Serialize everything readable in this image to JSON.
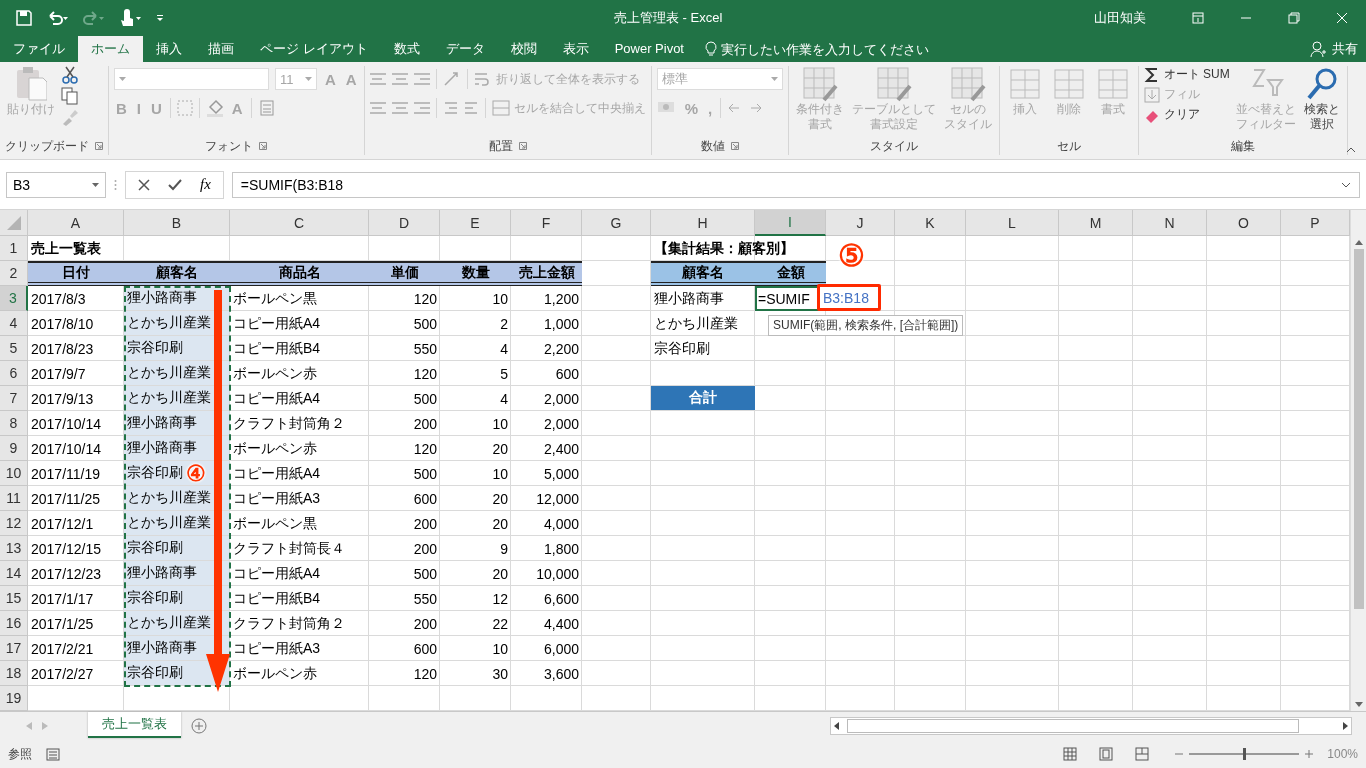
{
  "title_bar": {
    "title": "売上管理表 - Excel",
    "user": "山田知美"
  },
  "menu_tabs": [
    {
      "label": "ファイル",
      "selected": false
    },
    {
      "label": "ホーム",
      "selected": true
    },
    {
      "label": "挿入",
      "selected": false
    },
    {
      "label": "描画",
      "selected": false
    },
    {
      "label": "ページ レイアウト",
      "selected": false
    },
    {
      "label": "数式",
      "selected": false
    },
    {
      "label": "データ",
      "selected": false
    },
    {
      "label": "校閲",
      "selected": false
    },
    {
      "label": "表示",
      "selected": false
    },
    {
      "label": "Power Pivot",
      "selected": false
    }
  ],
  "tell_me": {
    "placeholder": "実行したい作業を入力してください"
  },
  "share": "共有",
  "ribbon": [
    {
      "label": "クリップボード",
      "commands": [
        {
          "lines": [
            "貼り付け"
          ],
          "disabled": true
        }
      ]
    },
    {
      "label": "フォント",
      "commands": [
        {
          "kind": "field",
          "disabled": true
        },
        {
          "kind": "field",
          "value": "11",
          "disabled": true
        },
        {
          "kind": "glyph",
          "label": "A",
          "disabled": true
        },
        {
          "kind": "glyph",
          "label": "A",
          "disabled": true
        },
        {
          "kind": "glyph",
          "label": "B",
          "disabled": true
        },
        {
          "kind": "glyph",
          "label": "I",
          "disabled": true
        },
        {
          "kind": "glyph",
          "label": "U",
          "disabled": true
        },
        {
          "kind": "glyph",
          "label": "A",
          "disabled": true
        }
      ]
    },
    {
      "label": "配置",
      "commands": [
        {
          "label": "折り返して全体を表示する",
          "disabled": true
        },
        {
          "label": "セルを結合して中央揃え",
          "disabled": true
        }
      ]
    },
    {
      "label": "数値",
      "commands": [
        {
          "kind": "field",
          "value": "標準",
          "disabled": true
        },
        {
          "kind": "glyph",
          "label": "%",
          "disabled": true
        },
        {
          "kind": "glyph",
          "label": ",",
          "disabled": true
        }
      ]
    },
    {
      "label": "スタイル",
      "commands": [
        {
          "lines": [
            "条件付き",
            "書式"
          ],
          "disabled": true
        },
        {
          "lines": [
            "テーブルとして",
            "書式設定"
          ],
          "disabled": true
        },
        {
          "lines": [
            "セルの",
            "スタイル"
          ],
          "disabled": true
        }
      ]
    },
    {
      "label": "セル",
      "commands": [
        {
          "lines": [
            "挿入"
          ],
          "disabled": true
        },
        {
          "lines": [
            "削除"
          ],
          "disabled": true
        },
        {
          "lines": [
            "書式"
          ],
          "disabled": true
        }
      ]
    },
    {
      "label": "編集",
      "commands": [
        {
          "label": "オート SUM",
          "disabled": false
        },
        {
          "label": "フィル",
          "disabled": true
        },
        {
          "label": "クリア",
          "disabled": false
        },
        {
          "lines": [
            "並べ替えと",
            "フィルター"
          ],
          "disabled": true
        },
        {
          "lines": [
            "検索と",
            "選択"
          ],
          "disabled": false
        }
      ]
    }
  ],
  "formula_bar": {
    "name_box": "B3",
    "function_button": "fx",
    "formula": "=SUMIF(B3:B18"
  },
  "sheet": {
    "columns": [
      {
        "label": "A",
        "selected": false,
        "range_marked": false
      },
      {
        "label": "B",
        "selected": false,
        "range_marked": true
      },
      {
        "label": "C",
        "selected": false,
        "range_marked": false
      },
      {
        "label": "D",
        "selected": false,
        "range_marked": false
      },
      {
        "label": "E",
        "selected": false,
        "range_marked": false
      },
      {
        "label": "F",
        "selected": false,
        "range_marked": false
      },
      {
        "label": "G",
        "selected": false,
        "range_marked": false
      },
      {
        "label": "H",
        "selected": false,
        "range_marked": false
      },
      {
        "label": "I",
        "selected": true,
        "range_marked": false
      },
      {
        "label": "J",
        "selected": false,
        "range_marked": false
      },
      {
        "label": "K",
        "selected": false,
        "range_marked": false
      },
      {
        "label": "L",
        "selected": false,
        "range_marked": false
      },
      {
        "label": "M",
        "selected": false,
        "range_marked": false
      },
      {
        "label": "N",
        "selected": false,
        "range_marked": false
      },
      {
        "label": "O",
        "selected": false,
        "range_marked": false
      },
      {
        "label": "P",
        "selected": false,
        "range_marked": false
      }
    ],
    "rows": [
      {
        "label": "1",
        "selected": false,
        "kind": "title",
        "cells": {
          "A": "売上一覧表",
          "H": "【集計結果：顧客別】"
        }
      },
      {
        "label": "2",
        "selected": false,
        "kind": "header",
        "cells": {
          "A": "日付",
          "B": "顧客名",
          "C": "商品名",
          "D": "単価",
          "E": "数量",
          "F": "売上金額",
          "H": "顧客名",
          "I": "金額"
        }
      },
      {
        "label": "3",
        "selected": true,
        "range_marked": true,
        "kind": "data",
        "cells": {
          "A": "2017/8/3",
          "B": "狸小路商事",
          "C": "ボールペン黒",
          "D": "120",
          "E": "10",
          "F": "1,200",
          "H": "狸小路商事",
          "I": "=SUMIF"
        }
      },
      {
        "label": "4",
        "selected": false,
        "range_marked": true,
        "kind": "data",
        "cells": {
          "A": "2017/8/10",
          "B": "とかち川産業",
          "C": "コピー用紙A4",
          "D": "500",
          "E": "2",
          "F": "1,000",
          "H": "とかち川産業"
        }
      },
      {
        "label": "5",
        "selected": false,
        "range_marked": true,
        "kind": "data",
        "cells": {
          "A": "2017/8/23",
          "B": "宗谷印刷",
          "C": "コピー用紙B4",
          "D": "550",
          "E": "4",
          "F": "2,200",
          "H": "宗谷印刷"
        }
      },
      {
        "label": "6",
        "selected": false,
        "range_marked": true,
        "kind": "data",
        "cells": {
          "A": "2017/9/7",
          "B": "とかち川産業",
          "C": "ボールペン赤",
          "D": "120",
          "E": "5",
          "F": "600"
        }
      },
      {
        "label": "7",
        "selected": false,
        "range_marked": true,
        "kind": "data",
        "cells": {
          "A": "2017/9/13",
          "B": "とかち川産業",
          "C": "コピー用紙A4",
          "D": "500",
          "E": "4",
          "F": "2,000",
          "H": {
            "text": "合計",
            "kind": "total"
          }
        }
      },
      {
        "label": "8",
        "selected": false,
        "range_marked": true,
        "kind": "data",
        "cells": {
          "A": "2017/10/14",
          "B": "狸小路商事",
          "C": "クラフト封筒角２",
          "D": "200",
          "E": "10",
          "F": "2,000"
        }
      },
      {
        "label": "9",
        "selected": false,
        "range_marked": true,
        "kind": "data",
        "cells": {
          "A": "2017/10/14",
          "B": "狸小路商事",
          "C": "ボールペン赤",
          "D": "120",
          "E": "20",
          "F": "2,400"
        }
      },
      {
        "label": "10",
        "selected": false,
        "range_marked": true,
        "kind": "data",
        "cells": {
          "A": "2017/11/19",
          "B": "宗谷印刷",
          "C": "コピー用紙A4",
          "D": "500",
          "E": "10",
          "F": "5,000"
        }
      },
      {
        "label": "11",
        "selected": false,
        "range_marked": true,
        "kind": "data",
        "cells": {
          "A": "2017/11/25",
          "B": "とかち川産業",
          "C": "コピー用紙A3",
          "D": "600",
          "E": "20",
          "F": "12,000"
        }
      },
      {
        "label": "12",
        "selected": false,
        "range_marked": true,
        "kind": "data",
        "cells": {
          "A": "2017/12/1",
          "B": "とかち川産業",
          "C": "ボールペン黒",
          "D": "200",
          "E": "20",
          "F": "4,000"
        }
      },
      {
        "label": "13",
        "selected": false,
        "range_marked": true,
        "kind": "data",
        "cells": {
          "A": "2017/12/15",
          "B": "宗谷印刷",
          "C": "クラフト封筒長４",
          "D": "200",
          "E": "9",
          "F": "1,800"
        }
      },
      {
        "label": "14",
        "selected": false,
        "range_marked": true,
        "kind": "data",
        "cells": {
          "A": "2017/12/23",
          "B": "狸小路商事",
          "C": "コピー用紙A4",
          "D": "500",
          "E": "20",
          "F": "10,000"
        }
      },
      {
        "label": "15",
        "selected": false,
        "range_marked": true,
        "kind": "data",
        "cells": {
          "A": "2017/1/17",
          "B": "宗谷印刷",
          "C": "コピー用紙B4",
          "D": "550",
          "E": "12",
          "F": "6,600"
        }
      },
      {
        "label": "16",
        "selected": false,
        "range_marked": true,
        "kind": "data",
        "cells": {
          "A": "2017/1/25",
          "B": "とかち川産業",
          "C": "クラフト封筒角２",
          "D": "200",
          "E": "22",
          "F": "4,400"
        }
      },
      {
        "label": "17",
        "selected": false,
        "range_marked": true,
        "kind": "data",
        "cells": {
          "A": "2017/2/21",
          "B": "狸小路商事",
          "C": "コピー用紙A3",
          "D": "600",
          "E": "10",
          "F": "6,000"
        }
      },
      {
        "label": "18",
        "selected": false,
        "range_marked": true,
        "kind": "data",
        "cells": {
          "A": "2017/2/27",
          "B": "宗谷印刷",
          "C": "ボールペン赤",
          "D": "120",
          "E": "30",
          "F": "3,600"
        }
      },
      {
        "label": "19",
        "selected": false,
        "kind": "data",
        "cells": {}
      }
    ]
  },
  "annotations": {
    "step_numbers": [
      "④",
      "⑤"
    ],
    "reference_box": "B3:B18",
    "tooltip": "SUMIF(範囲, 検索条件, [合計範囲])"
  },
  "sheet_tabs": [
    {
      "label": "売上一覧表",
      "selected": true
    }
  ],
  "status_bar": {
    "mode": "参照",
    "zoom": {
      "level": 0.5,
      "reading": "100%"
    }
  }
}
